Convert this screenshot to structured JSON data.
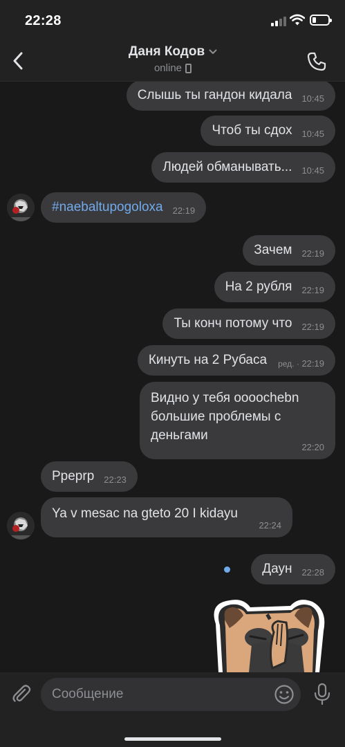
{
  "status_bar": {
    "time": "22:28"
  },
  "header": {
    "contact_name": "Даня Кодов",
    "status": "online"
  },
  "messages": [
    {
      "direction": "outgoing",
      "text": "Слышь ты гандон кидала",
      "time": "10:45"
    },
    {
      "direction": "outgoing",
      "text": "Чтоб ты сдох",
      "time": "10:45"
    },
    {
      "direction": "outgoing",
      "text": "Людей обманывать...",
      "time": "10:45"
    },
    {
      "direction": "incoming",
      "text": "#naebaltupogoloxa",
      "time": "22:19"
    },
    {
      "direction": "outgoing",
      "text": "Зачем",
      "time": "22:19"
    },
    {
      "direction": "outgoing",
      "text": "На 2 рубля",
      "time": "22:19"
    },
    {
      "direction": "outgoing",
      "text": "Ты конч потому что",
      "time": "22:19"
    },
    {
      "direction": "outgoing",
      "text": "Кинуть на 2 Рубаса",
      "time": "22:19",
      "edited_label": "ред. ·"
    },
    {
      "direction": "outgoing",
      "text": "Видно у тебя ооооchebn\nбольшие проблемы с\nденьгами",
      "time": "22:20"
    },
    {
      "direction": "incoming",
      "text": "Pреprр",
      "time": "22:23"
    },
    {
      "direction": "incoming",
      "text": "Ya v mesac na  gteto 20  I kidayu",
      "time": "22:24"
    },
    {
      "direction": "outgoing",
      "text": "Даун",
      "time": "22:28",
      "unread": true
    },
    {
      "direction": "outgoing",
      "type": "sticker",
      "sticker": "pug-facepalm-sticker"
    }
  ],
  "composer": {
    "placeholder": "Сообщение"
  },
  "icons": {
    "back": "chevron-left-icon",
    "call": "phone-icon",
    "attach": "paperclip-icon",
    "emoji": "smile-icon",
    "mic": "microphone-icon",
    "dropdown": "chevron-down-icon",
    "device": "mobile-phone-icon"
  },
  "colors": {
    "background": "#19191a",
    "bar": "#222222",
    "bubble": "#3a3a3c",
    "text": "#e1e3e6",
    "secondary_text": "#8c8e91",
    "link": "#71aaeb"
  }
}
